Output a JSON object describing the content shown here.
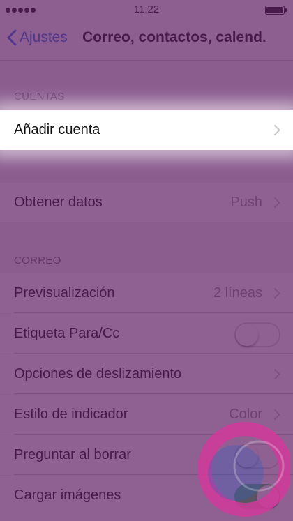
{
  "status_bar": {
    "time": "11:22",
    "signal_icon": "signal-dots-icon",
    "battery_icon": "battery-icon"
  },
  "nav": {
    "back_label": "Ajustes",
    "title": "Correo, contactos, calend."
  },
  "accounts": {
    "header": "CUENTAS",
    "add_account": "Añadir cuenta"
  },
  "fetch": {
    "label": "Obtener datos",
    "value": "Push"
  },
  "mail": {
    "header": "CORREO",
    "preview": {
      "label": "Previsualización",
      "value": "2 líneas"
    },
    "to_cc": {
      "label": "Etiqueta Para/Cc",
      "on": false
    },
    "swipe": {
      "label": "Opciones de deslizamiento"
    },
    "flag_style": {
      "label": "Estilo de indicador",
      "value": "Color"
    },
    "ask_delete": {
      "label": "Preguntar al borrar",
      "on": false
    },
    "load_images": {
      "label": "Cargar imágenes",
      "on": true
    }
  },
  "colors": {
    "accent": "#2f6fe0",
    "overlay": "#601e64",
    "toggle_on": "#4cd964"
  }
}
